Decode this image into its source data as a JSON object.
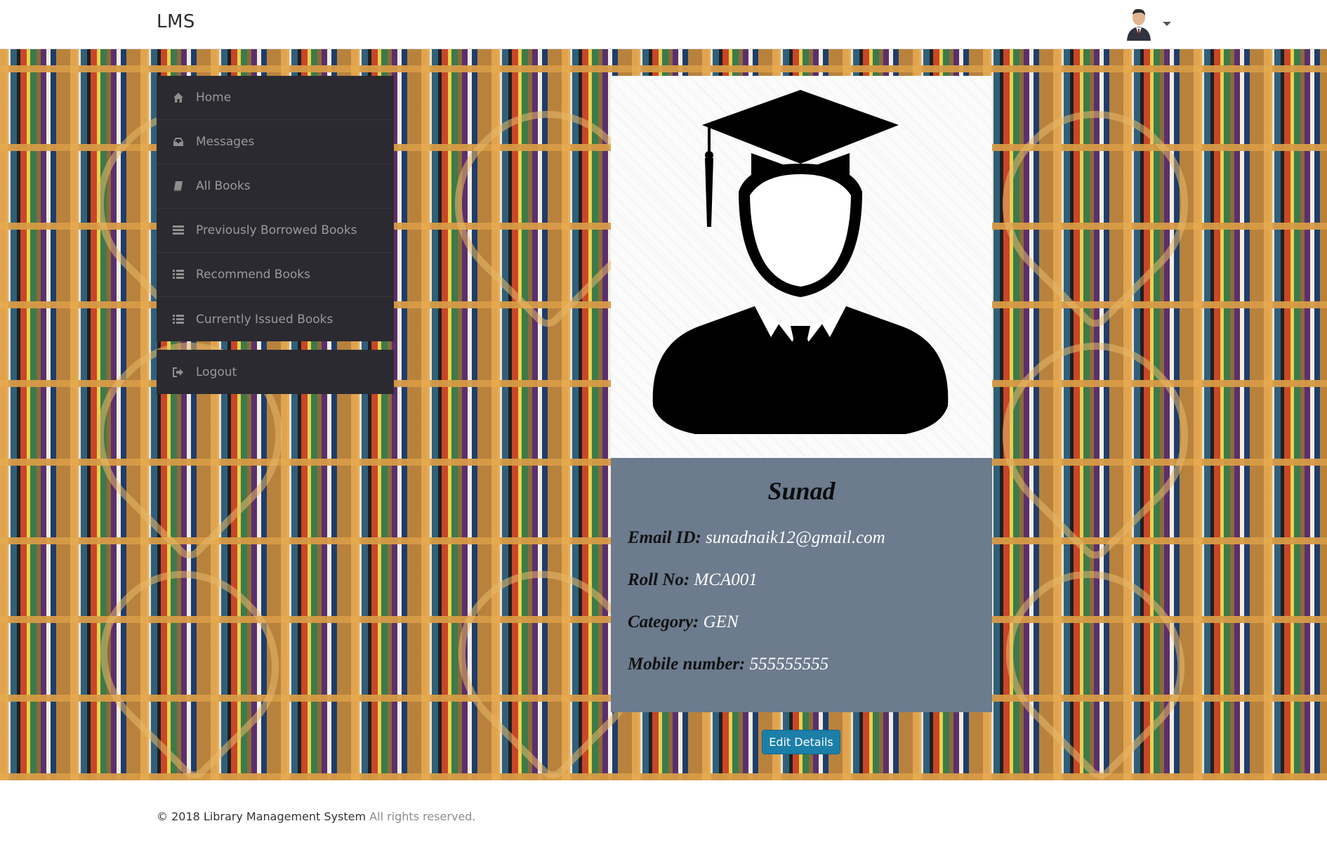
{
  "navbar": {
    "brand": "LMS",
    "user_avatar_icon": "user-avatar-icon",
    "dropdown_icon": "caret-down-icon"
  },
  "sidebar": {
    "items": [
      {
        "label": "Home",
        "icon": "home-icon"
      },
      {
        "label": "Messages",
        "icon": "inbox-icon"
      },
      {
        "label": "All Books",
        "icon": "book-icon"
      },
      {
        "label": "Previously Borrowed Books",
        "icon": "list-stack-icon"
      },
      {
        "label": "Recommend Books",
        "icon": "list-icon"
      },
      {
        "label": "Currently Issued Books",
        "icon": "list-icon"
      }
    ],
    "logout": {
      "label": "Logout",
      "icon": "sign-out-icon"
    }
  },
  "profile": {
    "photo_icon": "graduate-avatar-icon",
    "name": "Sunad",
    "email_label": "Email ID:",
    "email": "sunadnaik12@gmail.com",
    "roll_label": "Roll No:",
    "roll": "MCA001",
    "category_label": "Category:",
    "category": "GEN",
    "mobile_label": "Mobile number:",
    "mobile": "555555555"
  },
  "actions": {
    "edit_label": "Edit Details"
  },
  "footer": {
    "copyright": "© 2018 Library Management System",
    "rights": "All rights reserved."
  },
  "colors": {
    "sidebar_bg": "#2b2a30",
    "sidebar_text": "#9a9a9a",
    "card_info_bg": "#6c7b8d",
    "button_bg": "#1b7fa8"
  }
}
